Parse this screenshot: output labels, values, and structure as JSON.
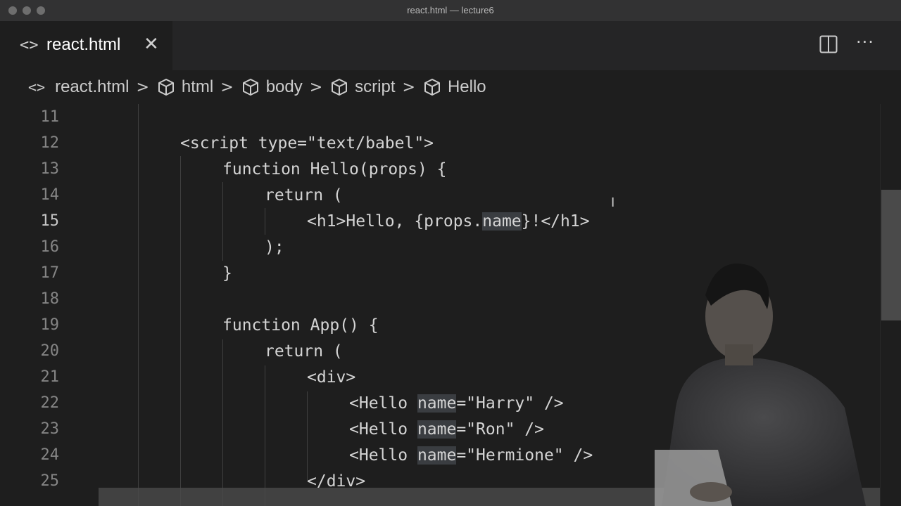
{
  "window": {
    "title": "react.html — lecture6"
  },
  "tab": {
    "icon": "code-brackets-icon",
    "icon_glyph": "<>",
    "label": "react.html",
    "close_glyph": "✕"
  },
  "actions": {
    "split_icon": "split-editor-icon",
    "more_glyph": "···"
  },
  "breadcrumb": {
    "items": [
      {
        "label": "react.html",
        "icon": "code-brackets-icon"
      },
      {
        "label": "html",
        "icon": "cube-icon"
      },
      {
        "label": "body",
        "icon": "cube-icon"
      },
      {
        "label": "script",
        "icon": "cube-icon"
      },
      {
        "label": "Hello",
        "icon": "cube-icon"
      }
    ],
    "separator": ">"
  },
  "editor": {
    "active_line": "15",
    "lines": [
      {
        "num": "11",
        "text": ""
      },
      {
        "num": "12",
        "text": "<script type=\"text/babel\">"
      },
      {
        "num": "13",
        "text": "function Hello(props) {"
      },
      {
        "num": "14",
        "text": "return ("
      },
      {
        "num": "15",
        "text_before": "<h1>Hello, {props.",
        "highlight": "name",
        "text_after": "}!</h1>"
      },
      {
        "num": "16",
        "text": ");"
      },
      {
        "num": "17",
        "text": "}"
      },
      {
        "num": "18",
        "text": ""
      },
      {
        "num": "19",
        "text": "function App() {"
      },
      {
        "num": "20",
        "text": "return ("
      },
      {
        "num": "21",
        "text": "<div>"
      },
      {
        "num": "22",
        "text_before": "<Hello ",
        "highlight": "name",
        "text_after": "=\"Harry\" />"
      },
      {
        "num": "23",
        "text_before": "<Hello ",
        "highlight": "name",
        "text_after": "=\"Ron\" />"
      },
      {
        "num": "24",
        "text_before": "<Hello ",
        "highlight": "name",
        "text_after": "=\"Hermione\" />"
      },
      {
        "num": "25",
        "text": "</div>"
      }
    ]
  },
  "colors": {
    "background": "#1e1e1e",
    "tabbar": "#252526",
    "titlebar": "#323233",
    "text": "#d4d4d4",
    "line_number": "#858585",
    "highlight": "#3a3d41"
  }
}
